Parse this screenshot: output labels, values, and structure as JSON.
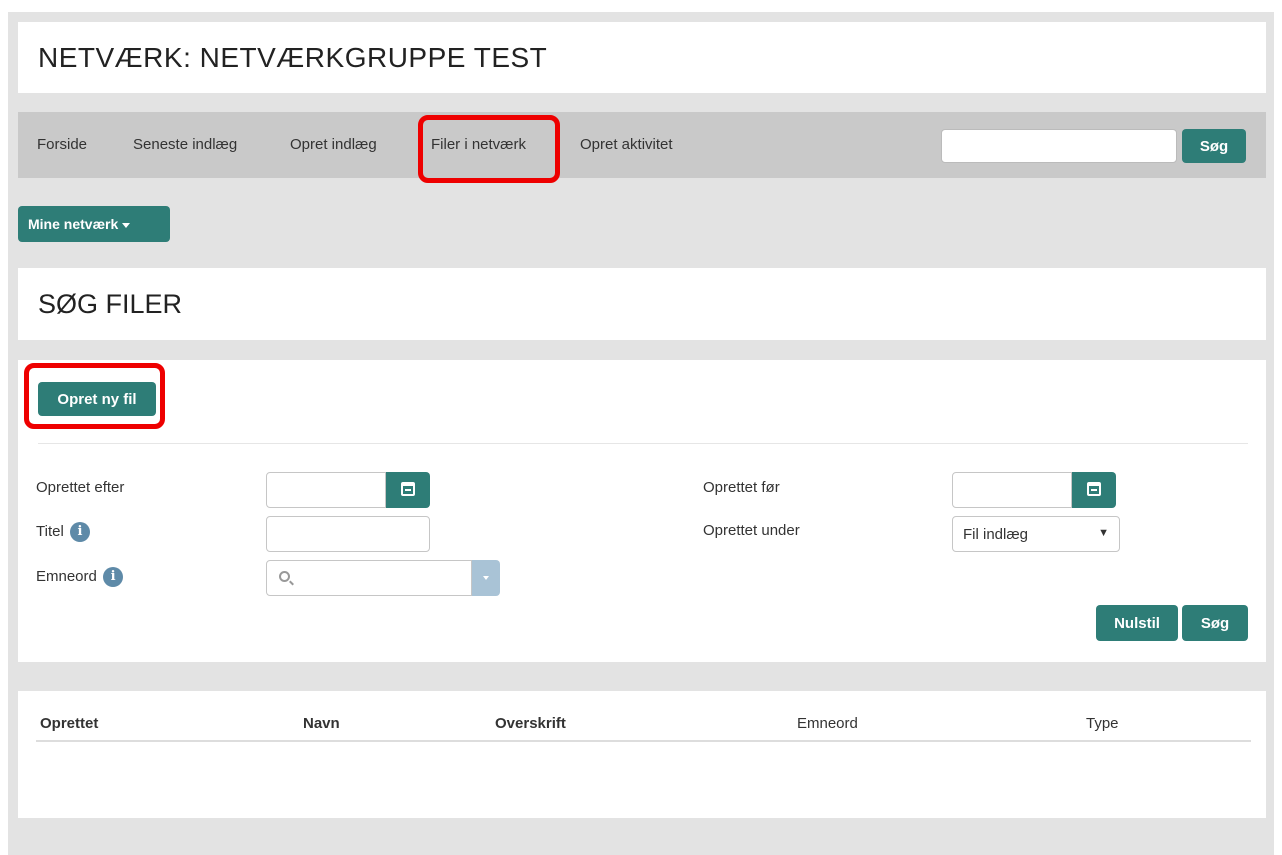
{
  "page": {
    "network_title": "NETVÆRK: NETVÆRKGRUPPE TEST",
    "section_title": "SØG FILER"
  },
  "nav": {
    "items": [
      {
        "label": "Forside"
      },
      {
        "label": "Seneste indlæg"
      },
      {
        "label": "Opret indlæg"
      },
      {
        "label": "Filer i netværk",
        "highlighted": true
      },
      {
        "label": "Opret aktivitet"
      }
    ],
    "search_value": "",
    "search_button": "Søg"
  },
  "mine_netvaerk": {
    "label": "Mine netværk",
    "icon": "caret-down-icon"
  },
  "form": {
    "create_button": "Opret ny fil",
    "created_after_label": "Oprettet efter",
    "created_after_value": "",
    "created_before_label": "Oprettet før",
    "created_before_value": "",
    "title_label": "Titel",
    "title_value": "",
    "created_under_label": "Oprettet under",
    "created_under_selected": "Fil indlæg",
    "keywords_label": "Emneord",
    "keywords_value": "",
    "reset_button": "Nulstil",
    "search_button": "Søg",
    "icons": {
      "calendar": "calendar-icon",
      "info": "info-icon",
      "search": "search-icon",
      "dropdown": "chevron-down-icon"
    }
  },
  "table": {
    "columns": [
      "Oprettet",
      "Navn",
      "Overskrift",
      "Emneord",
      "Type"
    ],
    "rows": []
  },
  "colors": {
    "accent": "#2e7d77",
    "highlight": "#ee0000",
    "nav_bg": "#c9c9c9",
    "page_bg": "#e3e3e3",
    "info_icon": "#5e8aa8"
  }
}
